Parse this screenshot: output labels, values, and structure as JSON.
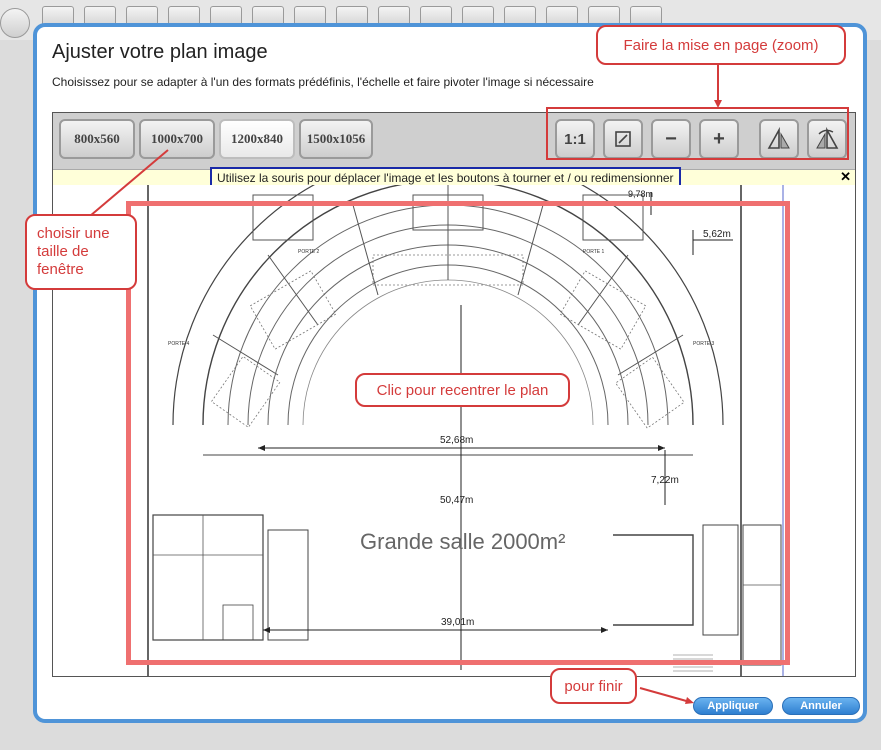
{
  "dialog": {
    "title": "Ajuster votre plan image",
    "subtitle": "Choisissez pour se adapter à l'un des formats prédéfinis, l'échelle et faire pivoter l'image si nécessaire"
  },
  "formats": [
    {
      "label": "800x560"
    },
    {
      "label": "1000x700"
    },
    {
      "label": "1200x840",
      "active": true
    },
    {
      "label": "1500x1056"
    }
  ],
  "tools": {
    "one_to_one": "1:1",
    "fit_icon": "fit-to-window-icon",
    "zoom_out": "−",
    "zoom_in": "+",
    "rotate_left_icon": "rotate-left-icon",
    "rotate_right_icon": "rotate-right-icon"
  },
  "notice": {
    "text": "Utilisez la souris pour déplacer l'image et les boutons à tourner et / ou redimensionner",
    "close": "✕"
  },
  "plan": {
    "hall_label": "Grande salle 2000m²",
    "dimensions": [
      "9,78m",
      "5,62m",
      "52,68m",
      "50,47m",
      "7,22m",
      "39,01m"
    ],
    "doors": [
      "PORTE 1",
      "PORTE 2",
      "PORTE 3",
      "PORTE 4"
    ]
  },
  "callouts": {
    "zoom": "Faire la mise en page (zoom)",
    "size": "choisir une taille de fenêtre",
    "recenter": "Clic pour recentrer le plan",
    "finish": "pour finir"
  },
  "actions": {
    "apply": "Appliquer",
    "cancel": "Annuler"
  },
  "colors": {
    "dialog_border": "#4f94d8",
    "annotation": "#d43b3b",
    "highlight_frame": "#ef7070",
    "notice_border": "#1a2aa8",
    "button_blue": "#2f7fd0"
  }
}
